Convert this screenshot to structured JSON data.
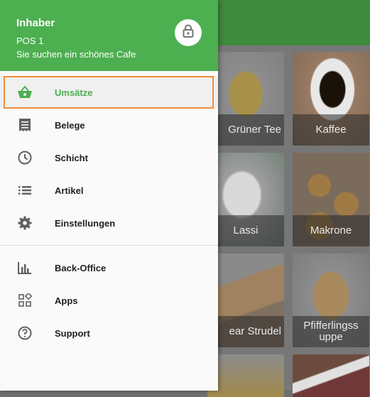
{
  "user": {
    "role": "Inhaber",
    "pos": "POS 1",
    "shop": "Sie suchen ein schönes Cafe"
  },
  "menu": {
    "primary": [
      {
        "label": "Umsätze",
        "icon": "basket-icon",
        "active": true
      },
      {
        "label": "Belege",
        "icon": "receipt-icon"
      },
      {
        "label": "Schicht",
        "icon": "clock-icon"
      },
      {
        "label": "Artikel",
        "icon": "list-icon"
      },
      {
        "label": "Einstellungen",
        "icon": "gear-icon"
      }
    ],
    "secondary": [
      {
        "label": "Back-Office",
        "icon": "bar-chart-icon"
      },
      {
        "label": "Apps",
        "icon": "apps-icon"
      },
      {
        "label": "Support",
        "icon": "help-icon"
      }
    ]
  },
  "products": [
    {
      "name": "Grüner Tee"
    },
    {
      "name": "Kaffee"
    },
    {
      "name": "Lassi"
    },
    {
      "name": "Makrone"
    },
    {
      "name": "ear Strudel"
    },
    {
      "name": "Pfifferlingss uppe"
    }
  ],
  "colors": {
    "accent": "#4caf50",
    "header": "#4caf50",
    "highlight": "#ef8c3c",
    "text": "#212121"
  }
}
